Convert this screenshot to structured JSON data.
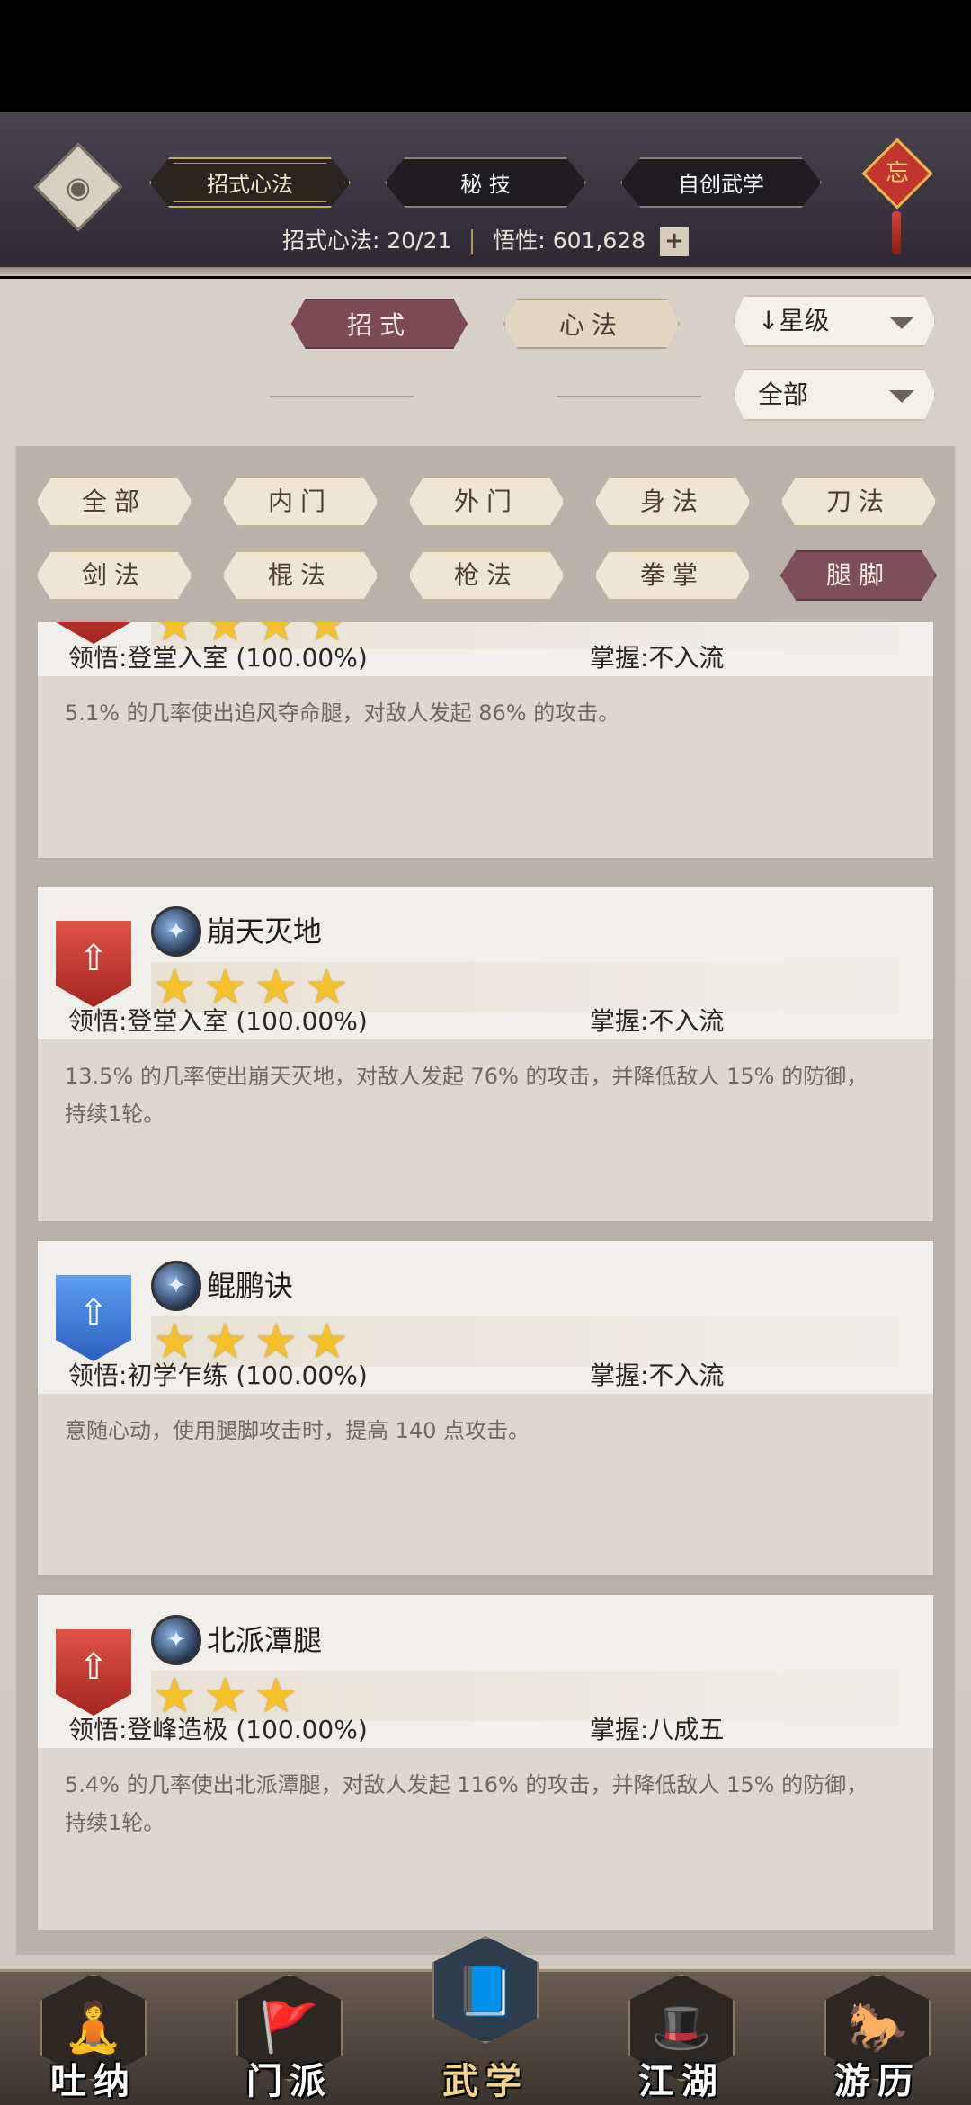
{
  "header": {
    "top_tabs": [
      "招式心法",
      "秘 技",
      "自创武学"
    ],
    "active_top_tab": 0,
    "knot_char": "忘",
    "stats_label": "招式心法:",
    "stats_value": "20/21",
    "insight_label": "悟性:",
    "insight_value": "601,628",
    "plus": "+"
  },
  "mode_tabs": [
    "招式",
    "心法"
  ],
  "active_mode": 0,
  "sort_dropdown": {
    "arrow": "↓",
    "label": "星级"
  },
  "scope_dropdown": {
    "label": "全部"
  },
  "filters": [
    "全部",
    "内门",
    "外门",
    "身法",
    "刀法",
    "剑法",
    "棍法",
    "枪法",
    "拳掌",
    "腿脚"
  ],
  "active_filter": 9,
  "skills": [
    {
      "name": "",
      "banner": "red",
      "stars": 4,
      "realm": "领悟:登堂入室 (100.00%)",
      "mastery": "掌握:不入流",
      "desc": "5.1% 的几率使出追风夺命腿，对敌人发起 86% 的攻击。"
    },
    {
      "name": "崩天灭地",
      "banner": "red",
      "stars": 4,
      "realm": "领悟:登堂入室 (100.00%)",
      "mastery": "掌握:不入流",
      "desc": "13.5% 的几率使出崩天灭地，对敌人发起 76% 的攻击，并降低敌人 15% 的防御，持续1轮。"
    },
    {
      "name": "鲲鹏诀",
      "banner": "blue",
      "stars": 4,
      "realm": "领悟:初学乍练 (100.00%)",
      "mastery": "掌握:不入流",
      "desc": "意随心动，使用腿脚攻击时，提高 140 点攻击。"
    },
    {
      "name": "北派潭腿",
      "banner": "red",
      "stars": 3,
      "realm": "领悟:登峰造极 (100.00%)",
      "mastery": "掌握:八成五",
      "desc": "5.4% 的几率使出北派潭腿，对敌人发起 116% 的攻击，并降低敌人 15% 的防御，持续1轮。"
    }
  ],
  "nav": [
    {
      "label": "吐纳",
      "icon": "monk-icon"
    },
    {
      "label": "门派",
      "icon": "flag-icon"
    },
    {
      "label": "武学",
      "icon": "book-icon"
    },
    {
      "label": "江湖",
      "icon": "hat-icon"
    },
    {
      "label": "游历",
      "icon": "horse-icon"
    }
  ],
  "active_nav": 2,
  "colors": {
    "accent": "#7c4b55",
    "star": "#f6c02a"
  }
}
